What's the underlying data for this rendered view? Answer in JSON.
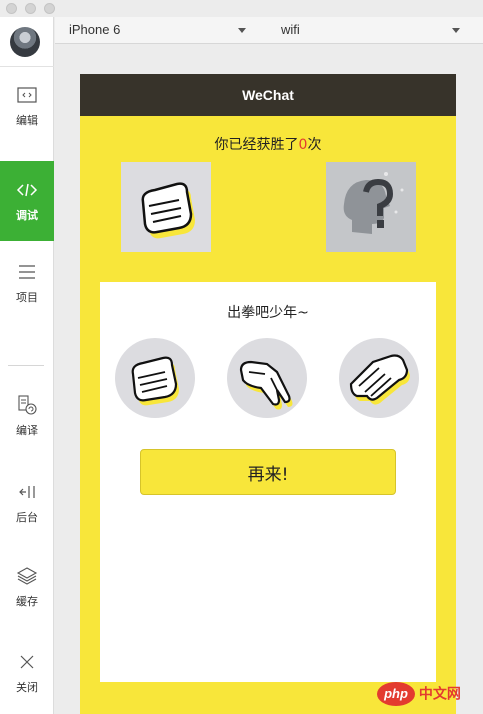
{
  "window": {
    "traffic_lights": [
      "close",
      "minimize",
      "zoom"
    ]
  },
  "sidebar": {
    "items": [
      {
        "label": "编辑",
        "icon": "code-file-icon"
      },
      {
        "label": "调试",
        "icon": "code-brackets-icon",
        "active": true
      },
      {
        "label": "项目",
        "icon": "menu-lines-icon"
      },
      {
        "label": "编译",
        "icon": "compile-icon"
      },
      {
        "label": "后台",
        "icon": "background-icon"
      },
      {
        "label": "缓存",
        "icon": "layers-icon"
      },
      {
        "label": "关闭",
        "icon": "close-icon"
      }
    ],
    "active_color": "#3cb035"
  },
  "toolbar": {
    "device": "iPhone 6",
    "network": "wifi"
  },
  "app": {
    "nav_title": "WeChat",
    "wins_prefix": "你已经获胜了",
    "wins_count": "0",
    "wins_suffix": "次",
    "player_choice_icon": "fist-icon",
    "opponent_icon": "question-head-icon",
    "prompt": "出拳吧少年~",
    "choices": [
      {
        "name": "rock",
        "icon": "rock-hand-icon"
      },
      {
        "name": "scissors",
        "icon": "scissors-hand-icon"
      },
      {
        "name": "paper",
        "icon": "paper-hand-icon"
      }
    ],
    "replay_label": "再来!",
    "colors": {
      "nav": "#37332a",
      "page": "#f8e63a",
      "count": "#e33b2f"
    }
  },
  "watermark": {
    "logo": "php",
    "text": "中文网"
  }
}
